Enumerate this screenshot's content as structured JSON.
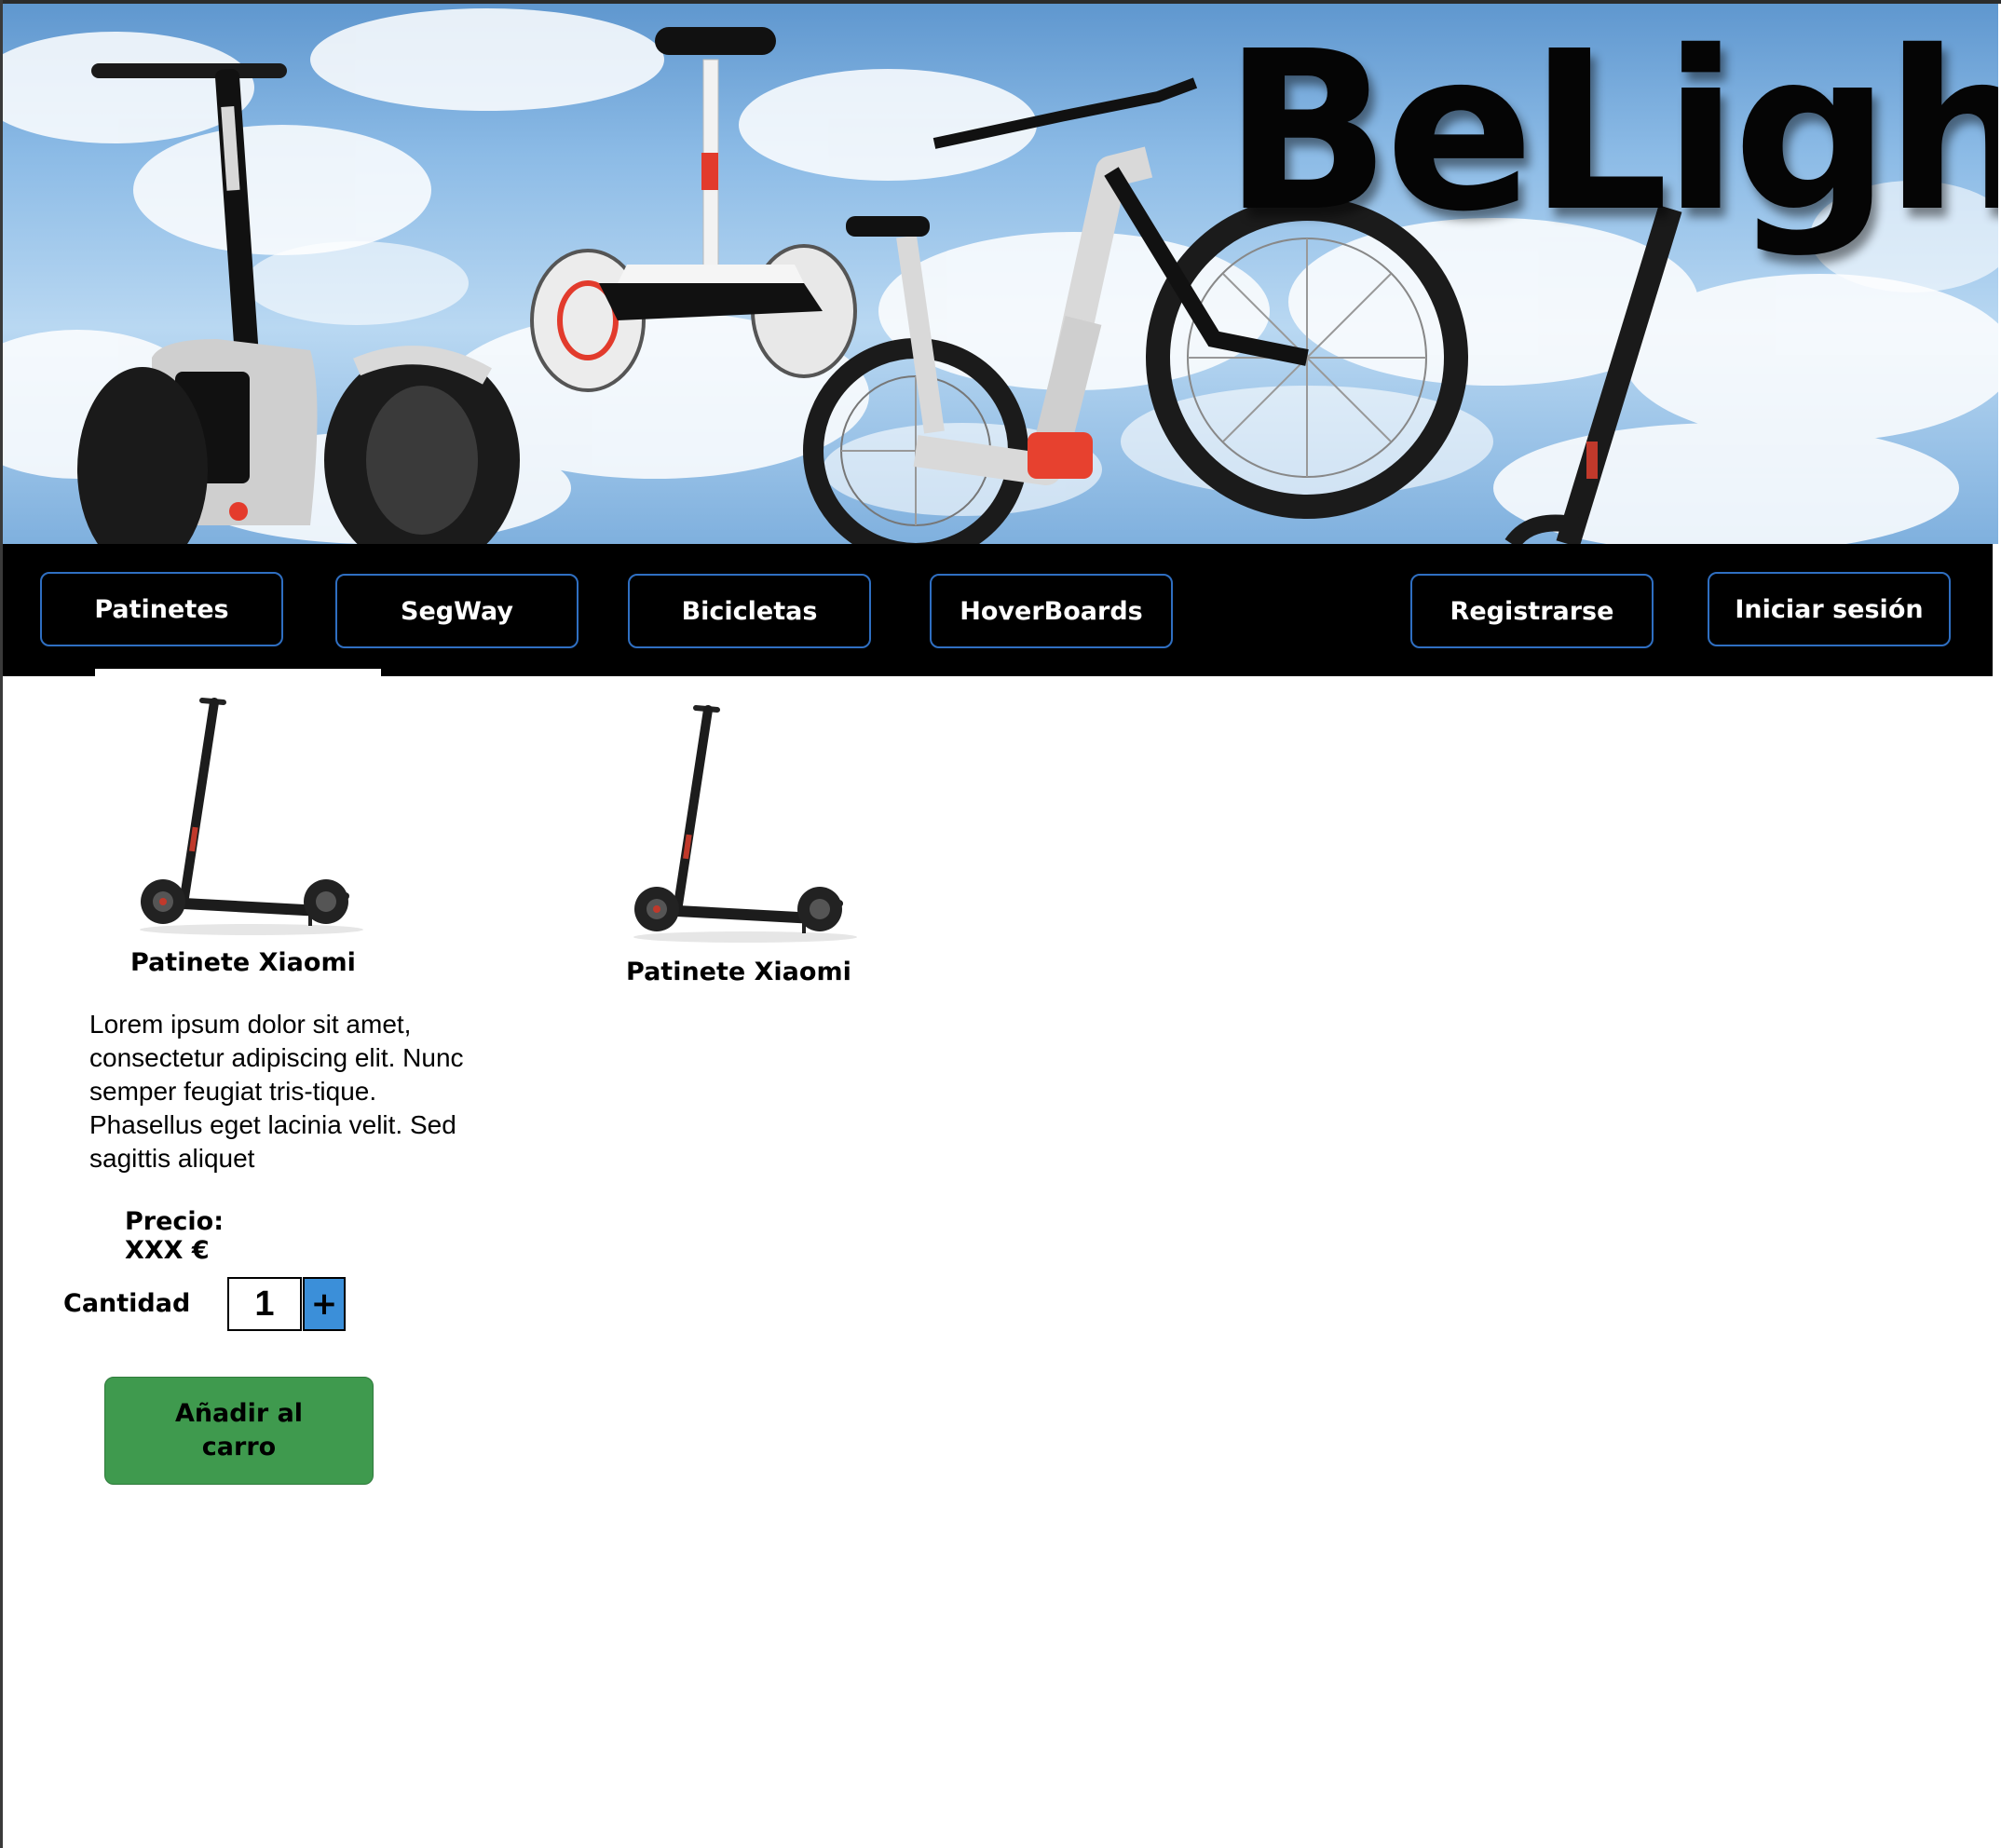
{
  "brand": {
    "logo_text": "BeLight"
  },
  "nav": {
    "categories": [
      {
        "label": "Patinetes"
      },
      {
        "label": "SegWay"
      },
      {
        "label": "Bicicletas"
      },
      {
        "label": "HoverBoards"
      }
    ],
    "account": {
      "register_label": "Registrarse",
      "login_label": "Iniciar sesión"
    }
  },
  "products": [
    {
      "title": "Patinete Xiaomi",
      "description": "Lorem ipsum dolor sit amet, consectetur adipiscing elit. Nunc semper feugiat tris-tique. Phasellus eget lacinia velit. Sed sagittis aliquet",
      "price_label": "Precio: XXX €",
      "quantity_label": "Cantidad",
      "quantity_value": "1",
      "plus_label": "+",
      "add_to_cart_label": "Añadir al carro"
    },
    {
      "title": "Patinete Xiaomi"
    }
  ],
  "icons": {
    "scooter": "scooter-image",
    "plus": "plus-icon"
  },
  "colors": {
    "nav_background": "#000000",
    "nav_border": "#2f6fc2",
    "add_to_cart": "#3f9a4e",
    "plus_button": "#3b8fd9"
  }
}
